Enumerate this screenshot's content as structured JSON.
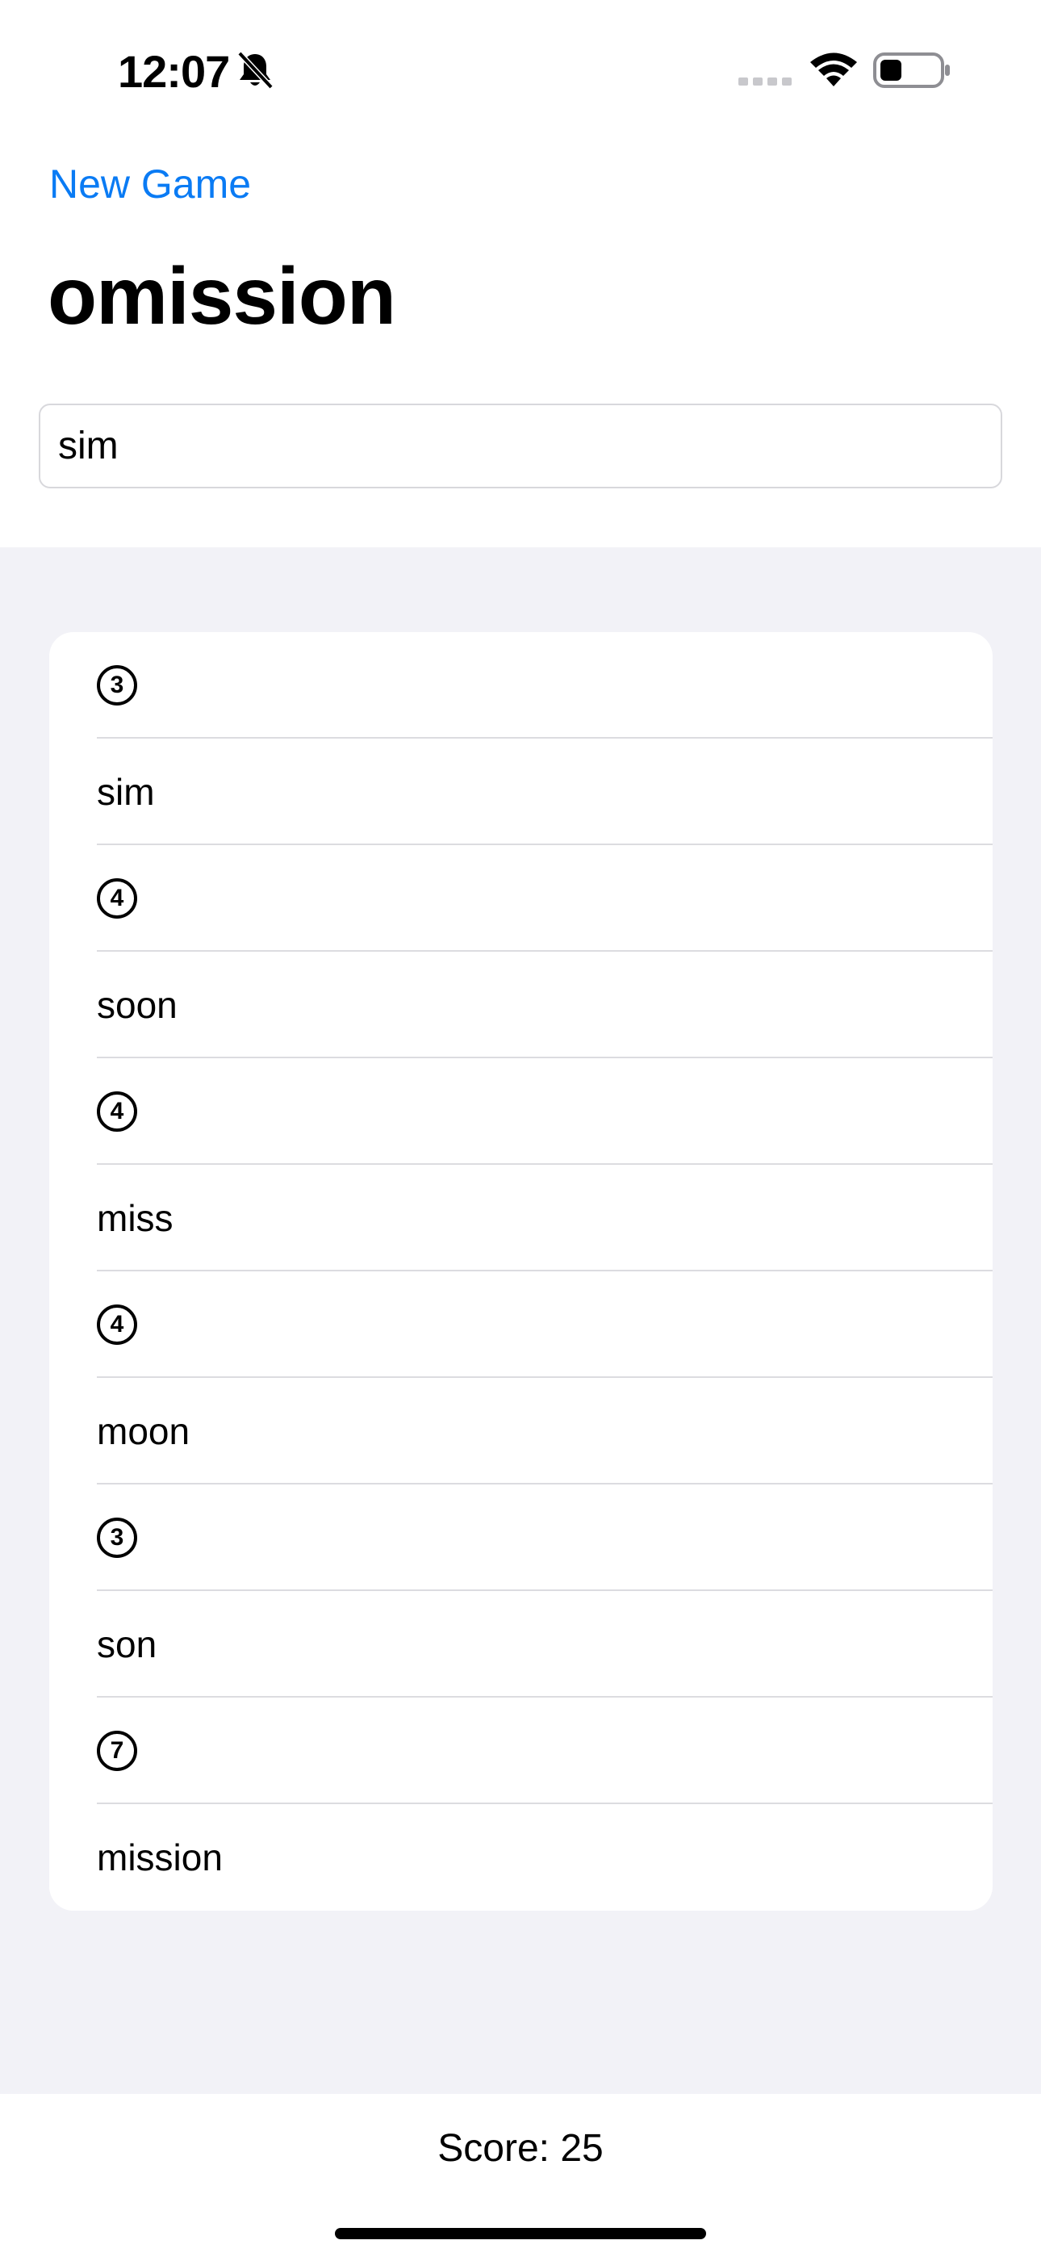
{
  "status_bar": {
    "time": "12:07",
    "icons": [
      "bell-slash-icon",
      "cellular-signal-icon",
      "wifi-icon",
      "battery-icon"
    ]
  },
  "nav": {
    "new_game_label": "New Game",
    "title": "omission"
  },
  "input": {
    "value": "sim"
  },
  "rows": [
    {
      "type": "count",
      "text": "3"
    },
    {
      "type": "word",
      "text": "sim"
    },
    {
      "type": "count",
      "text": "4"
    },
    {
      "type": "word",
      "text": "soon"
    },
    {
      "type": "count",
      "text": "4"
    },
    {
      "type": "word",
      "text": "miss"
    },
    {
      "type": "count",
      "text": "4"
    },
    {
      "type": "word",
      "text": "moon"
    },
    {
      "type": "count",
      "text": "3"
    },
    {
      "type": "word",
      "text": "son"
    },
    {
      "type": "count",
      "text": "7"
    },
    {
      "type": "word",
      "text": "mission"
    }
  ],
  "footer": {
    "score": "Score: 25"
  },
  "colors": {
    "accent": "#0a7bf4",
    "grouped_background": "#f2f2f7"
  }
}
